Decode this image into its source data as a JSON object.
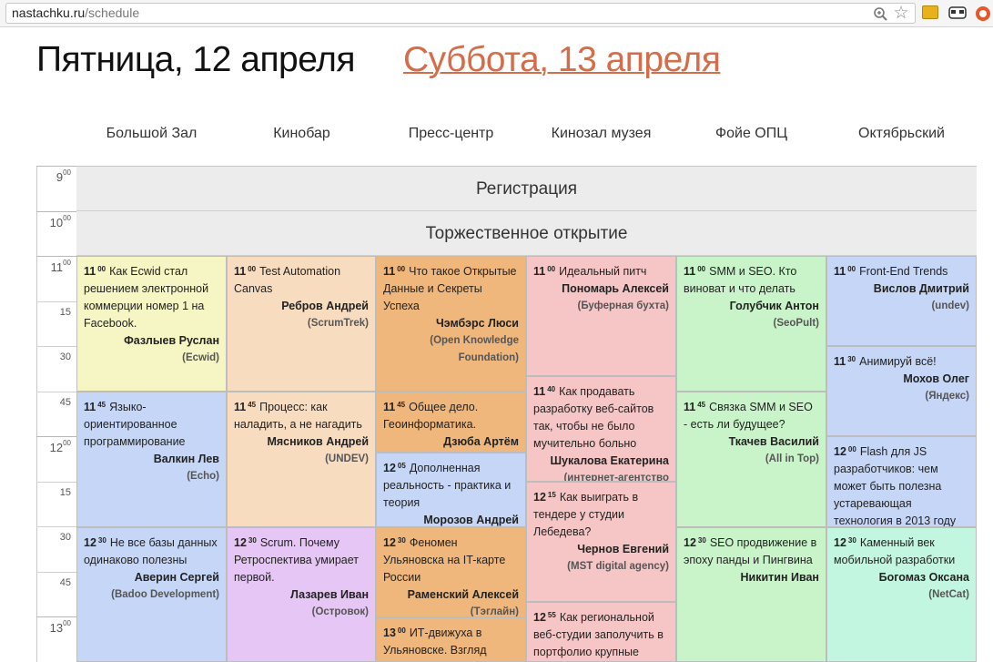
{
  "browser": {
    "url_host": "nastachku.ru",
    "url_path": "/schedule"
  },
  "days": {
    "active": "Пятница, 12 апреля",
    "other": "Суббота, 13 апреля"
  },
  "halls": [
    "Большой Зал",
    "Кинобар",
    "Пресс-центр",
    "Кинозал музея",
    "Фойе ОПЦ",
    "Октябрьский"
  ],
  "times": {
    "h9": "9",
    "h10": "10",
    "h11": "11",
    "h12": "12",
    "h13": "13",
    "m00": "00",
    "m15": "15",
    "m30": "30",
    "m45": "45"
  },
  "plenary": {
    "registration": "Регистрация",
    "opening": "Торжественное открытие"
  },
  "sessions": {
    "s1": {
      "h": "11",
      "m": "00",
      "title": "Как Ecwid стал решением электронной коммерции номер 1 на Facebook.",
      "speaker": "Фазлыев Руслан",
      "company": "(Ecwid)"
    },
    "s2": {
      "h": "11",
      "m": "00",
      "title": "Test Automation Canvas",
      "speaker": "Ребров Андрей",
      "company": "(ScrumTrek)"
    },
    "s3": {
      "h": "11",
      "m": "00",
      "title": "Что такое Открытые Данные и Секреты Успеха",
      "speaker": "Чэмбэрс Люси",
      "company": "(Open Knowledge Foundation)"
    },
    "s4": {
      "h": "11",
      "m": "00",
      "title": "Идеальный питч",
      "speaker": "Пономарь Алексей",
      "company": "(Буферная бухта)"
    },
    "s5": {
      "h": "11",
      "m": "00",
      "title": "SMM и SEO. Кто виноват и что делать",
      "speaker": "Голубчик Антон",
      "company": "(SeoPult)"
    },
    "s6": {
      "h": "11",
      "m": "00",
      "title": "Front-End Trends",
      "speaker": "Вислов Дмитрий",
      "company": "(undev)"
    },
    "s7": {
      "h": "11",
      "m": "30",
      "title": "Анимируй всё!",
      "speaker": "Мохов Олег",
      "company": "(Яндекс)"
    },
    "s8": {
      "h": "11",
      "m": "40",
      "title": "Как продавать разработку веб-сайтов так, чтобы не было мучительно больно",
      "speaker": "Шукалова Екатерина",
      "company": "(интернет-агентство"
    },
    "s9": {
      "h": "11",
      "m": "45",
      "title": "Языко-ориентированное программирование",
      "speaker": "Валкин Лев",
      "company": "(Echo)"
    },
    "s10": {
      "h": "11",
      "m": "45",
      "title": "Процесс: как наладить, а не нагадить",
      "speaker": "Мясников Андрей",
      "company": "(UNDEV)"
    },
    "s11": {
      "h": "11",
      "m": "45",
      "title": "Общее дело. Геоинформатика.",
      "speaker": "Дзюба Артём",
      "company": ""
    },
    "s12": {
      "h": "11",
      "m": "45",
      "title": "Связка SMM и SEO - есть ли будущее?",
      "speaker": "Ткачев Василий",
      "company": "(All in Top)"
    },
    "s13": {
      "h": "12",
      "m": "00",
      "title": "Flash для JS разработчиков: чем может быть полезна устаревающая технология в 2013 году",
      "speaker": "",
      "company": ""
    },
    "s14": {
      "h": "12",
      "m": "05",
      "title": "Дополненная реальность - практика и теория",
      "speaker": "Морозов Андрей",
      "company": ""
    },
    "s15": {
      "h": "12",
      "m": "15",
      "title": "Как выиграть в тендере у студии Лебедева?",
      "speaker": "Чернов Евгений",
      "company": "(MST digital agency)"
    },
    "s16": {
      "h": "12",
      "m": "30",
      "title": "Не все базы данных одинаково полезны",
      "speaker": "Аверин Сергей",
      "company": "(Badoo Development)"
    },
    "s17": {
      "h": "12",
      "m": "30",
      "title": "Scrum. Почему Ретроспектива умирает первой.",
      "speaker": "Лазарев Иван",
      "company": "(Островок)"
    },
    "s18": {
      "h": "12",
      "m": "30",
      "title": "Феномен Ульяновска на IT-карте России",
      "speaker": "Раменский Алексей",
      "company": "(Тэглайн)"
    },
    "s19": {
      "h": "12",
      "m": "30",
      "title": "SEO продвижение в эпоху панды и Пингвина",
      "speaker": "Никитин Иван",
      "company": ""
    },
    "s20": {
      "h": "12",
      "m": "30",
      "title": "Каменный век мобильной разработки",
      "speaker": "Богомаз Оксана",
      "company": "(NetCat)"
    },
    "s21": {
      "h": "12",
      "m": "55",
      "title": "Как региональной веб-студии заполучить в портфолио крупные",
      "speaker": "",
      "company": ""
    },
    "s22": {
      "h": "13",
      "m": "00",
      "title": "ИТ-движуха в Ульяновске. Взгляд",
      "speaker": "",
      "company": ""
    }
  },
  "colors": {
    "link": "#d56c4a",
    "yellow": "#f6f6c4",
    "peach": "#f8dcc0",
    "orange": "#f0b77c",
    "pink": "#f6c6c6",
    "green": "#c9f4c9",
    "blue": "#c6d6f6",
    "lilac": "#e6c6f4",
    "mint": "#c3f6e0"
  }
}
